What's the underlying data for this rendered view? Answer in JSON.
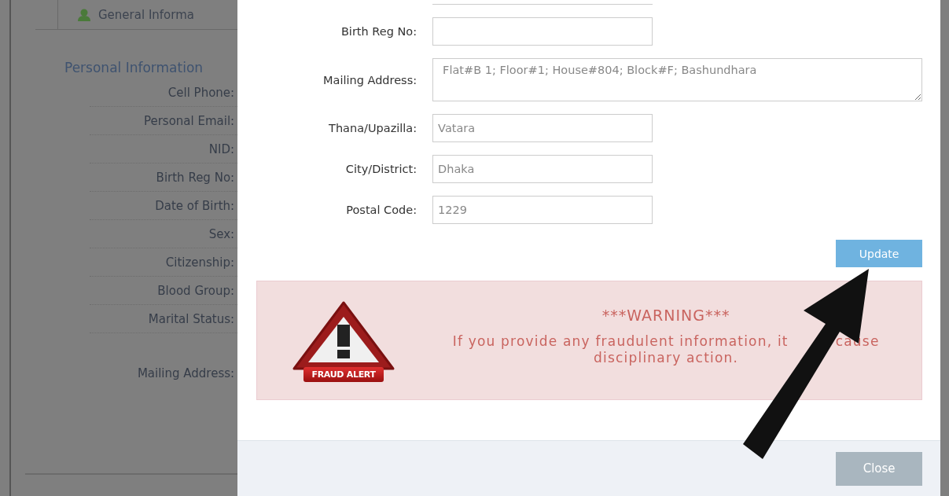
{
  "background": {
    "tab": {
      "label": "General Informa",
      "selected": true
    },
    "section_title": "Personal Information",
    "fields": [
      {
        "label": "Cell Phone:"
      },
      {
        "label": "Personal Email:"
      },
      {
        "label": "NID:"
      },
      {
        "label": "Birth Reg No:"
      },
      {
        "label": "Date of Birth:"
      },
      {
        "label": "Sex:"
      },
      {
        "label": "Citizenship:"
      },
      {
        "label": "Blood Group:"
      },
      {
        "label": "Marital Status:"
      },
      {
        "label": "Mailing Address:"
      }
    ]
  },
  "modal": {
    "fields": [
      {
        "label": "Birth Reg No:",
        "kind": "input"
      },
      {
        "label": "Mailing Address:",
        "kind": "textarea",
        "value": "Flat#B 1; Floor#1; House#804; Block#F; Bashundhara"
      },
      {
        "label": "Thana/Upazilla:",
        "kind": "input",
        "value": "Vatara"
      },
      {
        "label": "City/District:",
        "kind": "input",
        "value": "Dhaka"
      },
      {
        "label": "Postal Code:",
        "kind": "input",
        "value": "1229"
      }
    ],
    "update_button": "Update",
    "warning": {
      "badge": "FRAUD ALERT",
      "title": "***WARNING***",
      "message": [
        "If you provide any fraudulent information, it",
        "cause",
        "disciplinary action."
      ]
    },
    "close_button": "Close"
  }
}
